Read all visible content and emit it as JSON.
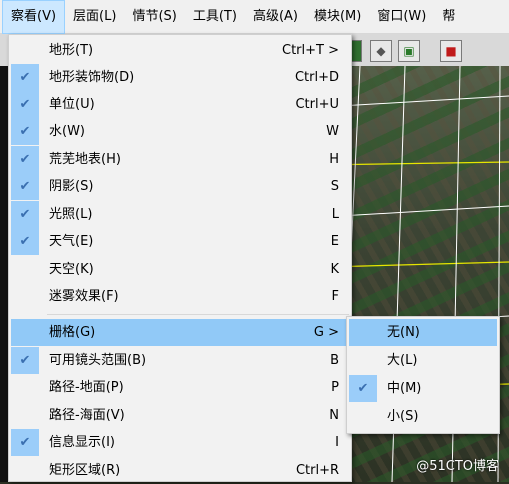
{
  "menubar": {
    "items": [
      "察看(V)",
      "层面(L)",
      "情节(S)",
      "工具(T)",
      "高级(A)",
      "模块(M)",
      "窗口(W)",
      "帮"
    ]
  },
  "view_menu": {
    "items": [
      {
        "label": "地形(T)",
        "shortcut": "Ctrl+T >",
        "checked": false
      },
      {
        "label": "地形装饰物(D)",
        "shortcut": "Ctrl+D",
        "checked": true
      },
      {
        "label": "单位(U)",
        "shortcut": "Ctrl+U",
        "checked": true
      },
      {
        "label": "水(W)",
        "shortcut": "W",
        "checked": true
      },
      {
        "label": "荒芜地表(H)",
        "shortcut": "H",
        "checked": true
      },
      {
        "label": "阴影(S)",
        "shortcut": "S",
        "checked": true
      },
      {
        "label": "光照(L)",
        "shortcut": "L",
        "checked": true
      },
      {
        "label": "天气(E)",
        "shortcut": "E",
        "checked": true
      },
      {
        "label": "天空(K)",
        "shortcut": "K",
        "checked": false
      },
      {
        "label": "迷雾效果(F)",
        "shortcut": "F",
        "checked": false
      },
      {
        "label": "栅格(G)",
        "shortcut": "G >",
        "checked": false
      },
      {
        "label": "可用镜头范围(B)",
        "shortcut": "B",
        "checked": true
      },
      {
        "label": "路径-地面(P)",
        "shortcut": "P",
        "checked": false
      },
      {
        "label": "路径-海面(V)",
        "shortcut": "N",
        "checked": false
      },
      {
        "label": "信息显示(I)",
        "shortcut": "I",
        "checked": true
      },
      {
        "label": "矩形区域(R)",
        "shortcut": "Ctrl+R",
        "checked": false
      }
    ]
  },
  "grid_submenu": {
    "items": [
      {
        "label": "无(N)",
        "checked": false
      },
      {
        "label": "大(L)",
        "checked": false
      },
      {
        "label": "中(M)",
        "checked": true
      },
      {
        "label": "小(S)",
        "checked": false
      }
    ]
  },
  "check_mark": "✔",
  "watermark": "@51CTO博客"
}
